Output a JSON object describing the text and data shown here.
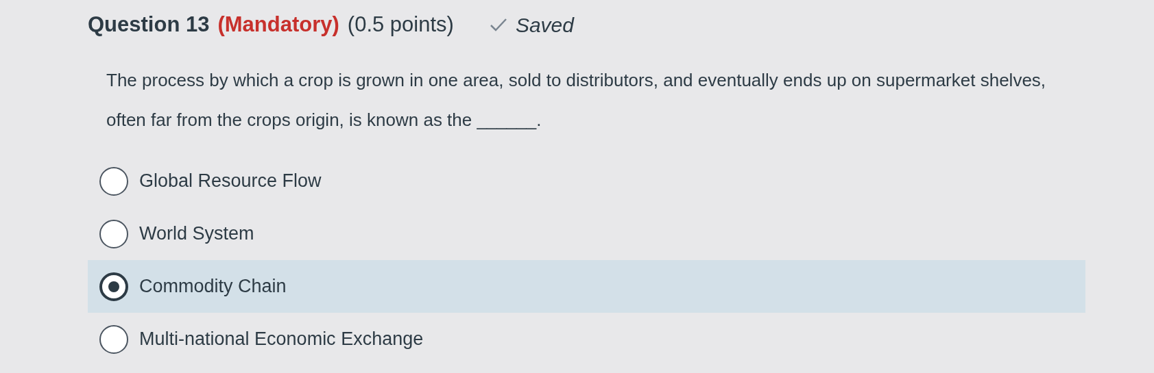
{
  "question": {
    "number": "Question 13",
    "mandatory": "(Mandatory)",
    "points": "(0.5 points)",
    "status": "Saved",
    "saved": true
  },
  "prompt": "The process by which a crop is grown in one area, sold to distributors, and eventually ends up on supermarket shelves, often far from the crops origin, is known as the ______.",
  "options": [
    {
      "label": "Global Resource Flow",
      "selected": false
    },
    {
      "label": "World System",
      "selected": false
    },
    {
      "label": "Commodity Chain",
      "selected": true
    },
    {
      "label": "Multi-national Economic Exchange",
      "selected": false
    }
  ]
}
